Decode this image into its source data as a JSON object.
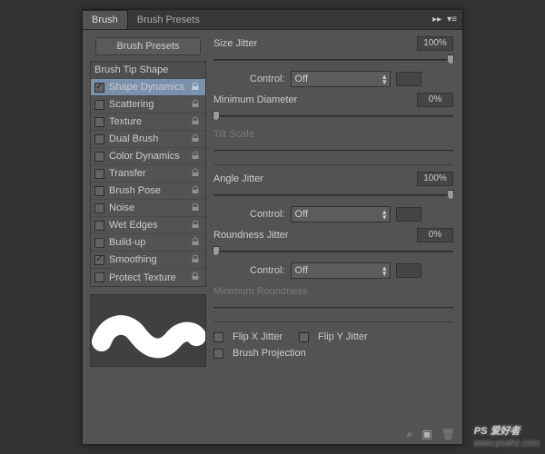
{
  "tabs": {
    "brush": "Brush",
    "presets": "Brush Presets"
  },
  "presets_btn": "Brush Presets",
  "list": {
    "tip": "Brush Tip Shape",
    "items": [
      {
        "label": "Shape Dynamics",
        "checked": true,
        "selected": true,
        "lock": true
      },
      {
        "label": "Scattering",
        "checked": false,
        "lock": true
      },
      {
        "label": "Texture",
        "checked": false,
        "lock": true
      },
      {
        "label": "Dual Brush",
        "checked": false,
        "lock": true
      },
      {
        "label": "Color Dynamics",
        "checked": false,
        "lock": true
      },
      {
        "label": "Transfer",
        "checked": false,
        "lock": true
      },
      {
        "label": "Brush Pose",
        "checked": false,
        "lock": true
      },
      {
        "label": "Noise",
        "checked": false,
        "lock": true
      },
      {
        "label": "Wet Edges",
        "checked": false,
        "lock": true
      },
      {
        "label": "Build-up",
        "checked": false,
        "lock": true
      },
      {
        "label": "Smoothing",
        "checked": true,
        "lock": true
      },
      {
        "label": "Protect Texture",
        "checked": false,
        "lock": true
      }
    ]
  },
  "ctrl": {
    "label": "Control:",
    "off": "Off"
  },
  "size": {
    "label": "Size Jitter",
    "val": "100%"
  },
  "mind": {
    "label": "Minimum Diameter",
    "val": "0%"
  },
  "tilt": {
    "label": "Tilt Scale"
  },
  "angle": {
    "label": "Angle Jitter",
    "val": "100%"
  },
  "round": {
    "label": "Roundness Jitter",
    "val": "0%"
  },
  "minr": {
    "label": "Minimum Roundness"
  },
  "flipx": "Flip X Jitter",
  "flipy": "Flip Y Jitter",
  "proj": "Brush Projection",
  "wm": {
    "main": "PS 爱好者",
    "sub": "www.psahz.com"
  }
}
